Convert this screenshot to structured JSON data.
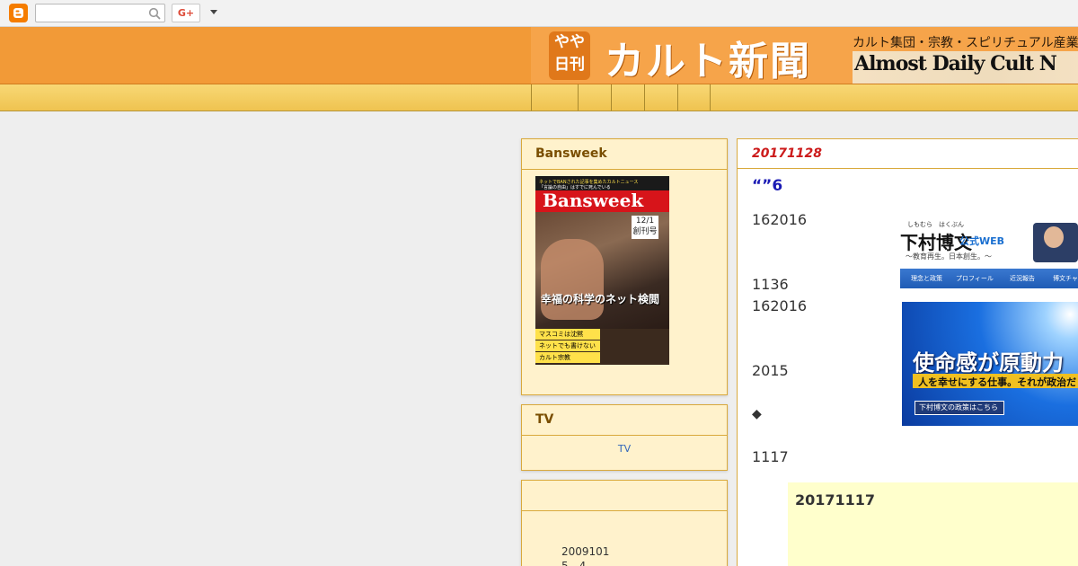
{
  "navbar": {
    "search_placeholder": "",
    "gplus_label": "G+"
  },
  "header": {
    "badge_line1": "やや",
    "badge_line2": "日刊",
    "title": "カルト新聞",
    "subtitle_jp": "カルト集団・宗教・スピリチュアル産業の",
    "subtitle_en": "Almost Daily Cult N"
  },
  "tabs": [
    "",
    "",
    "",
    "",
    ""
  ],
  "sidebar": {
    "bansweek": {
      "title": "Bansweek",
      "cover": {
        "top_line1": "ネットでBANされた記事を集めたカルトニュース",
        "top_line2": "「言論の自由」はすでに死んでいる",
        "name": "Bansweek",
        "date": "12/1",
        "date_sub": "創刊号",
        "headline": "幸福の科学のネット検閲",
        "tags": [
          "マスコミは沈黙",
          "ネットでも書けない",
          "カルト宗教"
        ]
      }
    },
    "tv": {
      "title": "TV",
      "link": "TV"
    },
    "archive": {
      "title": "",
      "line1": "2009101",
      "line2": "5　4"
    }
  },
  "post": {
    "date": "20171128",
    "title": "“”6",
    "lines": [
      "162016",
      "1136",
      "162016",
      "2015",
      "◆",
      "1117"
    ],
    "ad": {
      "ruby": "しもむら　はくぶん",
      "name": "下村博文",
      "web": "公式WEB",
      "slogan": "～教育再生。日本創生。～",
      "nav": [
        "理念と政策",
        "プロフィール",
        "近況報告",
        "博文チャ"
      ],
      "hero_title": "使命感が原動力",
      "hero_sub": "人を幸せにする仕事。それが政治だ",
      "hero_btn": "下村博文の政策はこちら"
    },
    "quote_title": "20171117"
  },
  "colors": {
    "header_bg": "#f29a37",
    "tabbar": "#f3ca5b",
    "widget_bg": "#fff2cc",
    "widget_border": "#d9a93c",
    "date_red": "#cc1b1b",
    "title_blue": "#1a1ab4"
  }
}
